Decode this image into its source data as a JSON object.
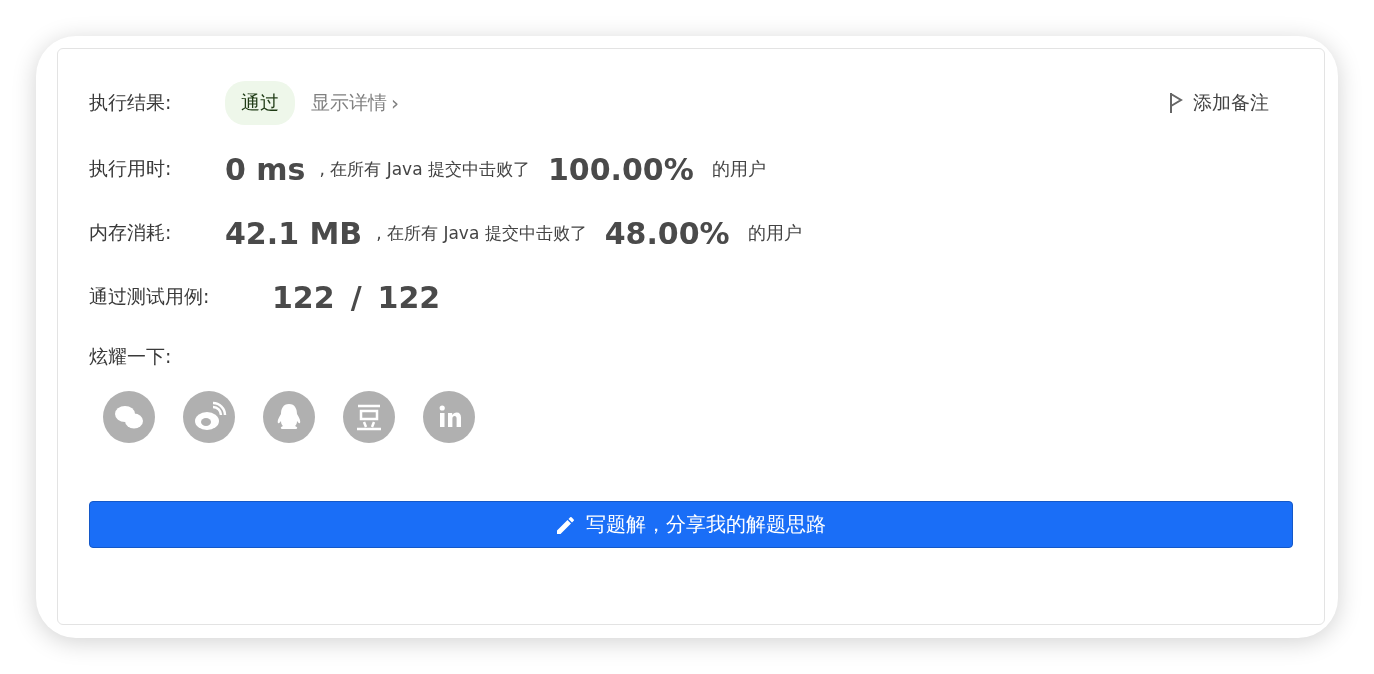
{
  "result": {
    "label": "执行结果:",
    "status": "通过",
    "details": "显示详情",
    "details_arrow": "›",
    "note": "添加备注"
  },
  "stats": [
    {
      "label": "执行用时:",
      "value": "0 ms",
      "text": ", 在所有 Java 提交中击败了",
      "percent": "100.00%",
      "suffix": "的用户"
    },
    {
      "label": "内存消耗:",
      "value": "42.1 MB",
      "text": ", 在所有 Java 提交中击败了",
      "percent": "48.00%",
      "suffix": "的用户"
    }
  ],
  "tests": {
    "label": "通过测试用例:",
    "passed": "122",
    "separator": "/",
    "total": "122"
  },
  "share": {
    "label": "炫耀一下:",
    "icons": [
      {
        "kind": "wechat"
      },
      {
        "kind": "weibo"
      },
      {
        "kind": "qq"
      },
      {
        "kind": "douban"
      },
      {
        "kind": "linkedin"
      }
    ]
  },
  "button": {
    "label": "写题解，分享我的解题思路"
  }
}
